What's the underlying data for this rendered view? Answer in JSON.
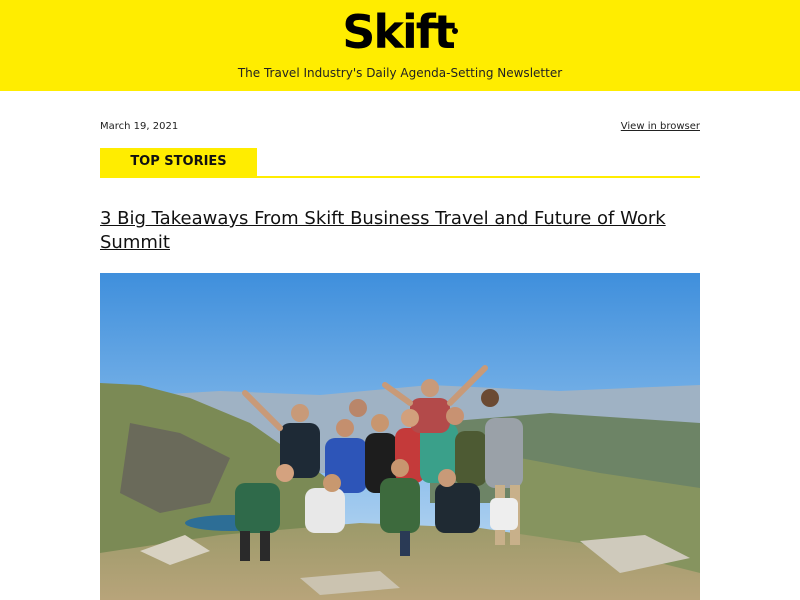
{
  "header": {
    "logo_text": "Skift",
    "tagline": "The Travel Industry's Daily Agenda-Setting Newsletter",
    "background_color": "#ffed00"
  },
  "meta": {
    "date": "March 19, 2021",
    "view_in_browser": "View in browser"
  },
  "section": {
    "label": "TOP STORIES"
  },
  "story": {
    "headline": "3 Big Takeaways From Skift Business Travel and Future of Work Summit",
    "image_subject": "group-of-hikers-photo"
  }
}
